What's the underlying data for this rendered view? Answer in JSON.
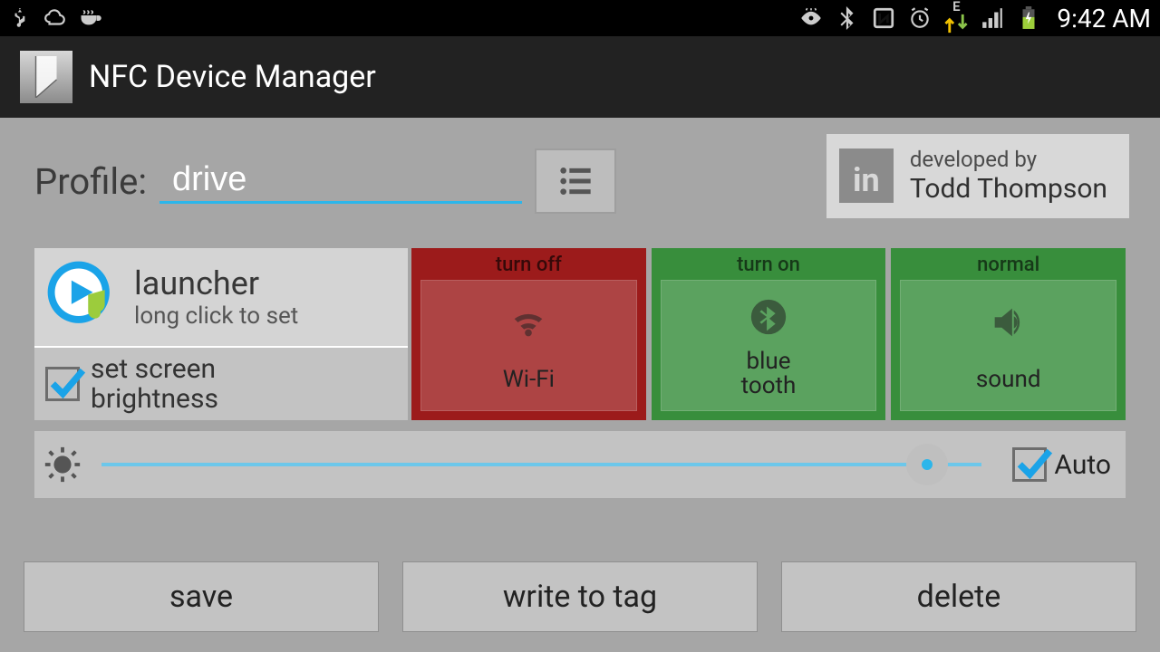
{
  "status": {
    "time": "9:42 AM",
    "network_type": "E"
  },
  "app": {
    "title": "NFC Device Manager"
  },
  "profile": {
    "label": "Profile:",
    "value": "drive"
  },
  "credit": {
    "line1": "developed by",
    "line2": "Todd Thompson"
  },
  "launcher": {
    "title": "launcher",
    "subtitle": "long click to set"
  },
  "brightness_toggle": {
    "label_line1": "set screen",
    "label_line2": "brightness",
    "checked": true
  },
  "tiles": {
    "wifi": {
      "header": "turn off",
      "label": "Wi-Fi"
    },
    "bluetooth": {
      "header": "turn on",
      "label_line1": "blue",
      "label_line2": "tooth"
    },
    "sound": {
      "header": "normal",
      "label": "sound"
    }
  },
  "slider": {
    "auto_label": "Auto",
    "auto_checked": true,
    "value_pct": 95
  },
  "buttons": {
    "save": "save",
    "write": "write to tag",
    "delete": "delete"
  }
}
